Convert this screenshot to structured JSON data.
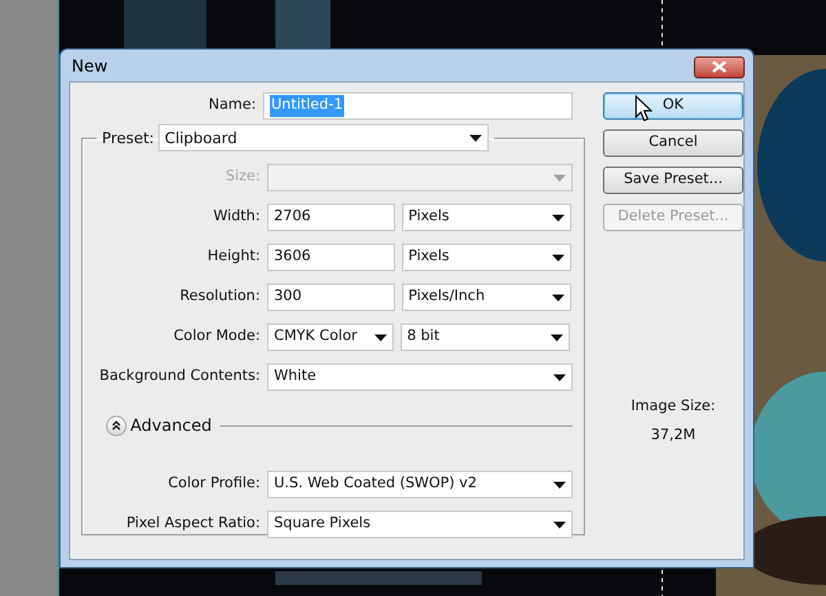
{
  "window": {
    "title": "New"
  },
  "name": {
    "label": "Name:",
    "value": "Untitled-1",
    "selected": true
  },
  "preset": {
    "label": "Preset:",
    "value": "Clipboard"
  },
  "rows": [
    {
      "label": "Size:",
      "disabled": true,
      "fields": [
        {
          "kind": "select"
        }
      ]
    },
    {
      "label": "Width:",
      "disabled": false,
      "fields": [
        {
          "kind": "input",
          "value": "2706"
        },
        {
          "kind": "select",
          "value": "Pixels"
        }
      ]
    },
    {
      "label": "Height:",
      "disabled": false,
      "fields": [
        {
          "kind": "input",
          "value": "3606"
        },
        {
          "kind": "select",
          "value": "Pixels"
        }
      ]
    },
    {
      "label": "Resolution:",
      "disabled": false,
      "fields": [
        {
          "kind": "input",
          "value": "300"
        },
        {
          "kind": "select",
          "value": "Pixels/Inch"
        }
      ]
    },
    {
      "label": "Color Mode:",
      "disabled": false,
      "fields": [
        {
          "kind": "select",
          "value": "CMYK Color"
        },
        {
          "kind": "select",
          "value": "8 bit"
        }
      ]
    },
    {
      "label": "Background Contents:",
      "disabled": false,
      "fields": [
        {
          "kind": "select",
          "value": "White"
        }
      ]
    }
  ],
  "advanced": {
    "label": "Advanced",
    "expanded": true,
    "rows": [
      {
        "label": "Color Profile:",
        "value": "U.S. Web Coated (SWOP) v2"
      },
      {
        "label": "Pixel Aspect Ratio:",
        "value": "Square Pixels"
      }
    ]
  },
  "buttons": [
    {
      "label": "OK",
      "default": true,
      "disabled": false
    },
    {
      "label": "Cancel",
      "default": false,
      "disabled": false
    },
    {
      "label": "Save Preset...",
      "default": false,
      "disabled": false
    },
    {
      "label": "Delete Preset...",
      "default": false,
      "disabled": true
    }
  ],
  "image_size": {
    "label": "Image Size:",
    "value": "37,2M"
  }
}
